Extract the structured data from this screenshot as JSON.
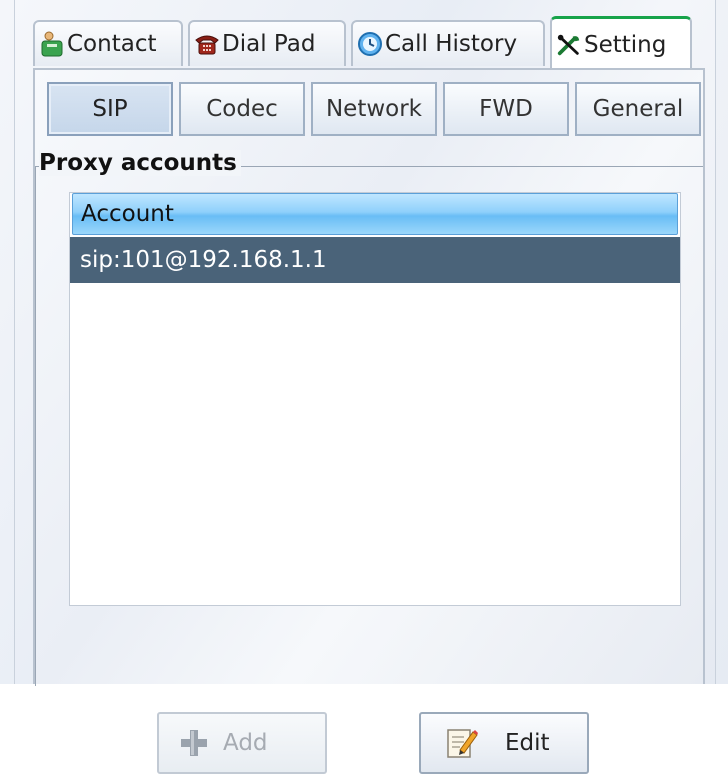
{
  "tabs": [
    {
      "label": "Contact",
      "icon": "contact-icon"
    },
    {
      "label": "Dial Pad",
      "icon": "telephone-icon"
    },
    {
      "label": "Call History",
      "icon": "clock-icon"
    },
    {
      "label": "Setting",
      "icon": "tools-icon"
    }
  ],
  "active_tab": "Setting",
  "subtabs": [
    {
      "label": "SIP"
    },
    {
      "label": "Codec"
    },
    {
      "label": "Network"
    },
    {
      "label": "FWD"
    },
    {
      "label": "General"
    }
  ],
  "active_subtab": "SIP",
  "group": {
    "title": "Proxy accounts"
  },
  "accounts_list": {
    "header": "Account",
    "rows": [
      "sip:101@192.168.1.1"
    ],
    "selected_row": 0
  },
  "buttons": {
    "add_label": "Add",
    "edit_label": "Edit"
  },
  "colors": {
    "active_tab_accent": "#17a34a",
    "selection": "#4a6379",
    "header_blue": "#8fd0fb"
  }
}
